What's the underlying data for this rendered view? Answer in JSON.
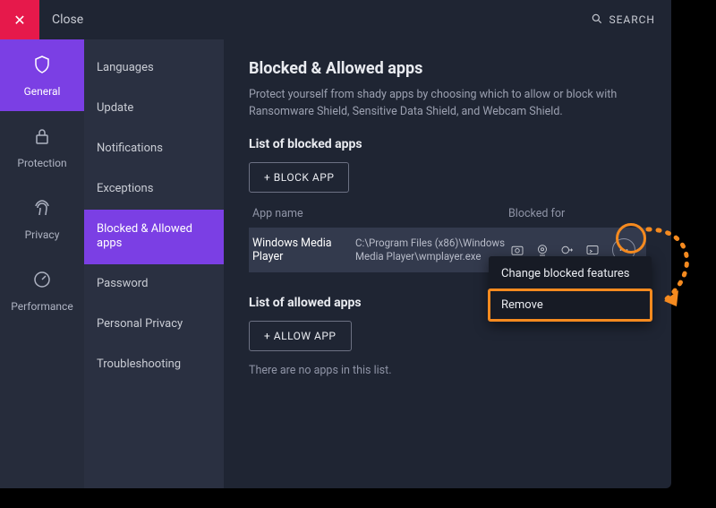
{
  "titlebar": {
    "close_label": "Close",
    "search_label": "SEARCH"
  },
  "rail": [
    {
      "id": "general",
      "label": "General",
      "active": true
    },
    {
      "id": "protection",
      "label": "Protection",
      "active": false
    },
    {
      "id": "privacy",
      "label": "Privacy",
      "active": false
    },
    {
      "id": "performance",
      "label": "Performance",
      "active": false
    }
  ],
  "subnav": [
    {
      "label": "Languages"
    },
    {
      "label": "Update"
    },
    {
      "label": "Notifications"
    },
    {
      "label": "Exceptions"
    },
    {
      "label": "Blocked & Allowed apps",
      "active": true
    },
    {
      "label": "Password"
    },
    {
      "label": "Personal Privacy"
    },
    {
      "label": "Troubleshooting"
    }
  ],
  "page": {
    "title": "Blocked & Allowed apps",
    "description": "Protect yourself from shady apps by choosing which to allow or block with Ransomware Shield, Sensitive Data Shield, and Webcam Shield.",
    "blocked_heading": "List of blocked apps",
    "block_button": "+ BLOCK APP",
    "col_appname": "App name",
    "col_blockedfor": "Blocked for",
    "allowed_heading": "List of allowed apps",
    "allow_button": "+ ALLOW APP",
    "empty_allowed": "There are no apps in this list."
  },
  "blocked_apps": [
    {
      "name": "Windows Media Player",
      "path": "C:\\Program Files (x86)\\Windows Media Player\\wmplayer.exe"
    }
  ],
  "context_menu": {
    "change": "Change blocked features",
    "remove": "Remove"
  }
}
